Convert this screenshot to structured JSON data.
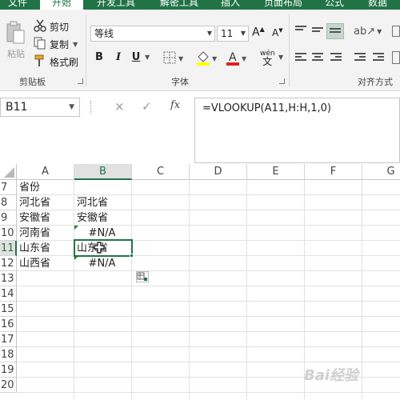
{
  "ribbon": {
    "tabs": [
      "文件",
      "开始",
      "开发工具",
      "解密工具",
      "插入",
      "页面布局",
      "公式",
      "数据"
    ],
    "active_tab": "开始",
    "clipboard": {
      "paste_label": "粘贴",
      "cut_label": "剪切",
      "copy_label": "复制",
      "format_painter_label": "格式刷",
      "group_label": "剪贴板"
    },
    "font": {
      "font_name": "等线",
      "font_size": "11",
      "bold": "B",
      "italic": "I",
      "underline": "U",
      "phonetic": "wén",
      "group_label": "字体"
    },
    "alignment": {
      "group_label": "对齐方式"
    }
  },
  "formula_bar": {
    "name_box": "B11",
    "cancel_icon": "×",
    "enter_icon": "✓",
    "fx_label": "fx",
    "formula": "=VLOOKUP(A11,H:H,1,0)"
  },
  "grid": {
    "columns": [
      "A",
      "B",
      "C",
      "D",
      "E",
      "F",
      "G"
    ],
    "selected_column": "B",
    "rows": [
      "7",
      "8",
      "9",
      "10",
      "11",
      "12",
      "13",
      "14",
      "15",
      "16",
      "17",
      "18",
      "19",
      "20"
    ],
    "selected_row": "11",
    "cells": {
      "A7": "省份",
      "A8": "河北省",
      "A9": "安徽省",
      "A10": "河南省",
      "A11": "山东省",
      "A12": "山西省",
      "B8": "河北省",
      "B9": "安徽省",
      "B10": "#N/A",
      "B11": "山东省",
      "B12": "#N/A"
    }
  },
  "watermark": "Bai经验",
  "colors": {
    "accent": "#217346",
    "error_indicator": "#1e7b34"
  }
}
